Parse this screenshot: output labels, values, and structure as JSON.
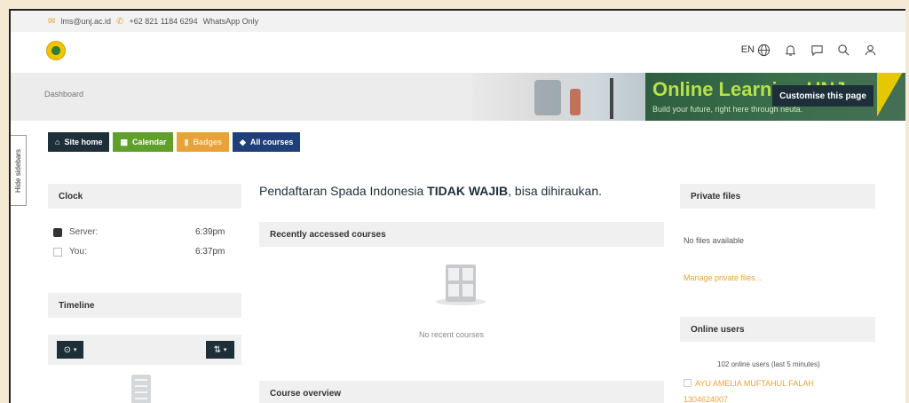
{
  "topbar": {
    "email": "lms@unj.ac.id",
    "phone": "+62 821 1184 6294",
    "phone_note": "WhatsApp Only"
  },
  "navbar": {
    "language": "EN",
    "icons": [
      "globe-icon",
      "bell-icon",
      "chat-icon",
      "search-icon",
      "user-icon"
    ]
  },
  "banner": {
    "breadcrumb": "Dashboard",
    "title": "Online Learning UNJ",
    "subtitle": "Build your future, right here through neuta.",
    "customise_label": "Customise this page"
  },
  "sidebar_toggle": "Hide sidebars",
  "quicknav": {
    "site_home": "Site home",
    "calendar": "Calendar",
    "badges": "Badges",
    "all_courses": "All courses"
  },
  "clock": {
    "heading": "Clock",
    "server_label": "Server:",
    "server_time": "6:39pm",
    "you_label": "You:",
    "you_time": "6:37pm"
  },
  "timeline": {
    "heading": "Timeline",
    "filter_icon": "clock-icon",
    "sort_icon": "sort-icon"
  },
  "main": {
    "title_prefix": "Pendaftaran Spada Indonesia ",
    "title_bold": "TIDAK WAJIB",
    "title_suffix": ", bisa dihiraukan.",
    "recent_heading": "Recently accessed courses",
    "no_recent": "No recent courses",
    "overview_heading": "Course overview"
  },
  "private_files": {
    "heading": "Private files",
    "empty": "No files available",
    "manage_link": "Manage private files..."
  },
  "online_users": {
    "heading": "Online users",
    "summary": "102 online users (last 5 minutes)",
    "user_name": "AYU AMELIA MUFTAHUL FALAH",
    "user_id": "1304624007"
  },
  "colors": {
    "dark": "#1e2f3a",
    "calendar": "#5ea02a",
    "badges": "#e8a23a",
    "courses": "#1f3f7a",
    "link": "#e8a23a"
  }
}
